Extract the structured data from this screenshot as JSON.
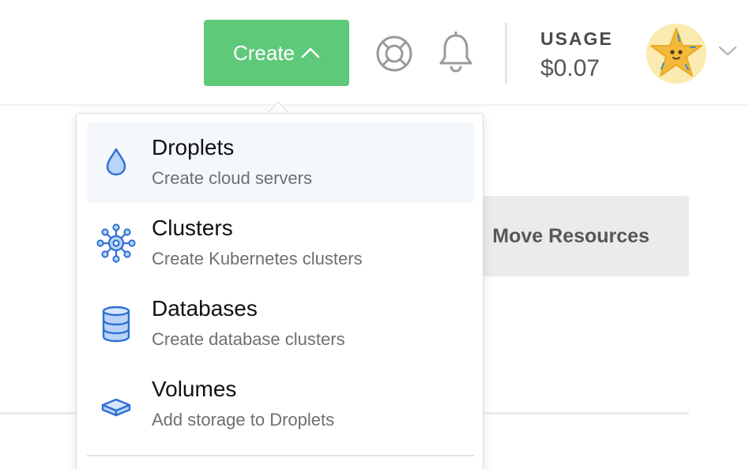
{
  "header": {
    "create_label": "Create",
    "usage_label": "USAGE",
    "usage_value": "$0.07"
  },
  "background": {
    "move_resources_label": "Move Resources"
  },
  "create_menu": {
    "items": [
      {
        "title": "Droplets",
        "subtitle": "Create cloud servers",
        "icon": "droplet-icon"
      },
      {
        "title": "Clusters",
        "subtitle": "Create Kubernetes clusters",
        "icon": "kubernetes-icon"
      },
      {
        "title": "Databases",
        "subtitle": "Create database clusters",
        "icon": "database-icon"
      },
      {
        "title": "Volumes",
        "subtitle": "Add storage to Droplets",
        "icon": "volume-icon"
      }
    ]
  },
  "colors": {
    "primary_green": "#5fc97a",
    "icon_blue": "#2f6fd6",
    "icon_fill": "#b9d4f7",
    "active_item_bg": "#f4f8fd"
  }
}
